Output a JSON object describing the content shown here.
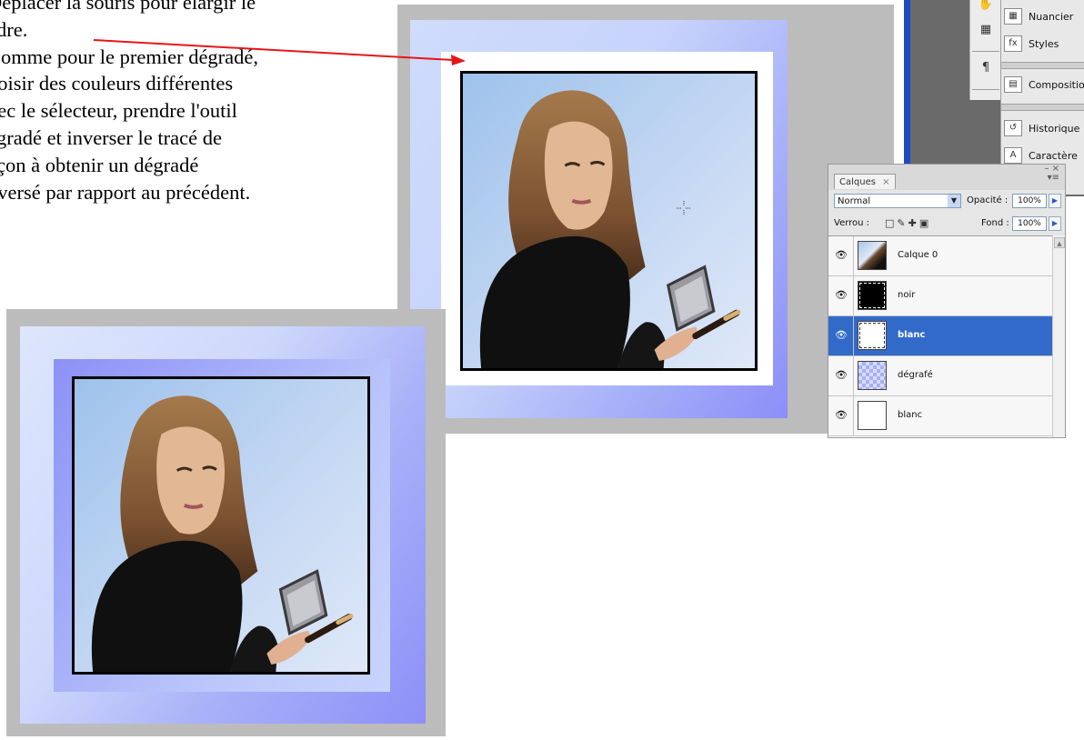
{
  "instructions": {
    "lines": [
      "Déplacer la souris pour élargir le",
      "adre.",
      "Comme pour le premier dégradé,",
      "hoisir des couleurs différentes",
      "vec le sélecteur, prendre l'outil",
      "égradé et inverser le tracé de",
      "açon à obtenir un dégradé",
      "nversé par rapport au précédent."
    ]
  },
  "colors": {
    "arrow": "#e8141c",
    "selection": "#326ac9",
    "gradient_light": "#cfdcfb",
    "gradient_dark": "#8c8ef7"
  },
  "panels": {
    "items": [
      {
        "label": "Nuancier",
        "icon": "swatches-icon"
      },
      {
        "label": "Styles",
        "icon": "styles-icon"
      },
      {
        "label": "Compositio",
        "icon": "layer-comps-icon"
      },
      {
        "label": "Historique",
        "icon": "history-icon"
      },
      {
        "label": "Caractère",
        "icon": "character-icon"
      }
    ]
  },
  "layers_panel": {
    "tab_label": "Calques",
    "close_glyph": "×",
    "blend_mode": "Normal",
    "opacity_label": "Opacité :",
    "opacity_value": "100%",
    "lock_label": "Verrou :",
    "fill_label": "Fond :",
    "fill_value": "100%",
    "layers": [
      {
        "name": "Calque 0",
        "thumb": "photo",
        "visible": true,
        "selected": false
      },
      {
        "name": "noir",
        "thumb": "black",
        "visible": true,
        "selected": false
      },
      {
        "name": "blanc",
        "thumb": "white-dashed",
        "visible": true,
        "selected": true
      },
      {
        "name": "dégrafé",
        "thumb": "checker",
        "visible": true,
        "selected": false
      },
      {
        "name": "blanc",
        "thumb": "white",
        "visible": true,
        "selected": false
      }
    ]
  }
}
